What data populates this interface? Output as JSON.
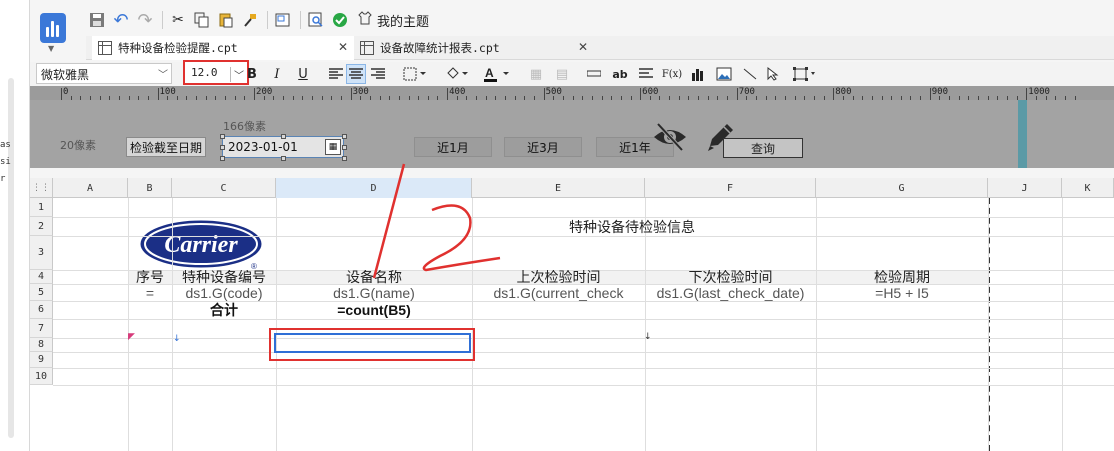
{
  "left_gutter": {
    "fragments": [
      "as",
      "si",
      "r"
    ]
  },
  "app_logo": {
    "icon": "bar-chart-logo-icon"
  },
  "top_toolbar": {
    "buttons": [
      {
        "name": "save-icon",
        "glyph": "💾"
      },
      {
        "name": "undo-icon",
        "glyph": "↶"
      },
      {
        "name": "redo-icon",
        "glyph": "↷"
      },
      {
        "name": "cut-icon",
        "glyph": "✂"
      },
      {
        "name": "copy-icon",
        "glyph": "⎘"
      },
      {
        "name": "paste-icon",
        "glyph": "📋"
      },
      {
        "name": "format-painter-icon",
        "glyph": "🖌"
      },
      {
        "name": "preview-icon",
        "glyph": "⧉"
      },
      {
        "name": "search-report-icon",
        "glyph": "🔍"
      },
      {
        "name": "check-icon",
        "glyph": "✔"
      }
    ],
    "theme_label": "我的主题"
  },
  "tabs": [
    {
      "label": "特种设备检验提醒.cpt",
      "active": true
    },
    {
      "label": "设备故障统计报表.cpt",
      "active": false
    }
  ],
  "format_toolbar": {
    "font_family": "微软雅黑",
    "font_size": "12.0",
    "bold": "B",
    "italic": "I",
    "underline": "U",
    "text_style_label": "ab",
    "formula_label": "F(x)"
  },
  "parameter_panel": {
    "ruler_labels": [
      "0",
      "100",
      "200",
      "300",
      "400",
      "500",
      "600",
      "700",
      "800",
      "900",
      "1000"
    ],
    "width_hint": "166像素",
    "px_hint": "20像素",
    "date_label": "检验截至日期",
    "date_value": "2023-01-01",
    "buttons": [
      "近1月",
      "近3月",
      "近1年"
    ],
    "query_label": "查询",
    "hide_icon": "eye-slash-icon",
    "edit_icon": "pencil-icon"
  },
  "sheet": {
    "columns": [
      "A",
      "B",
      "C",
      "D",
      "E",
      "F",
      "G",
      "J",
      "K"
    ],
    "rows": [
      "1",
      "2",
      "3",
      "4",
      "5",
      "6",
      "7",
      "8",
      "9",
      "10"
    ],
    "logo_text": "Carrier",
    "title": "特种设备待检验信息",
    "headers": [
      "序号",
      "特种设备编号",
      "设备名称",
      "上次检验时间",
      "下次检验时间",
      "检验周期"
    ],
    "row5": [
      "=",
      "ds1.G(code)",
      "ds1.G(name)",
      "ds1.G(current_check",
      "ds1.G(last_check_date)",
      "=H5 + I5"
    ],
    "row6": [
      "合计",
      "=count(B5)"
    ]
  },
  "annotation_text": "12",
  "colors": {
    "highlight_red": "#e0312f",
    "selection_blue": "#2f6fd6",
    "logo_navy": "#1b2f86"
  }
}
